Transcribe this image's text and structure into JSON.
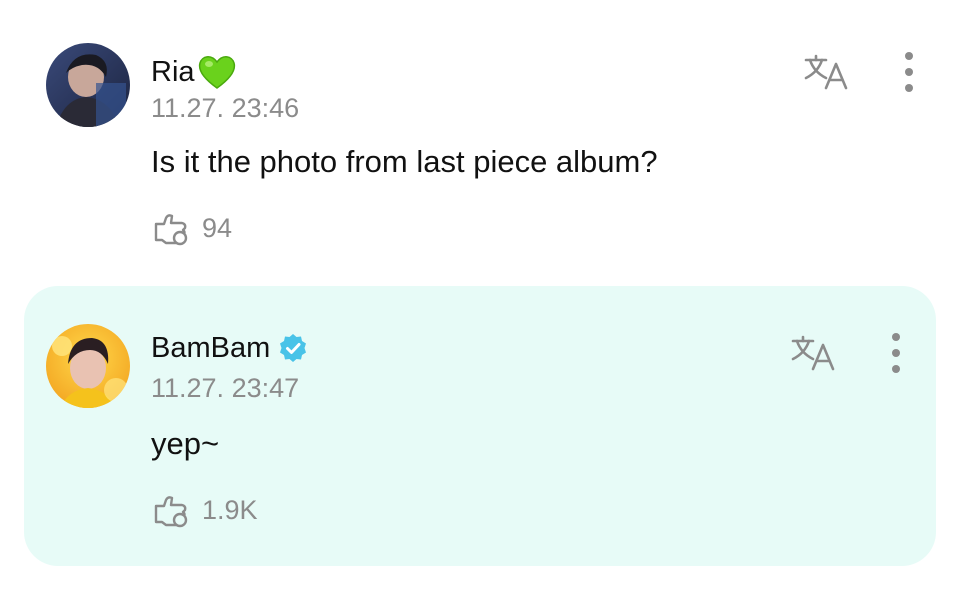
{
  "comments": [
    {
      "author": "Ria",
      "author_emoji": "green-heart-icon",
      "timestamp": "11.27. 23:46",
      "text": "Is it the photo from last piece album?",
      "likes": "94",
      "highlighted": false
    },
    {
      "author": "BamBam",
      "verified": true,
      "timestamp": "11.27. 23:47",
      "text": "yep~",
      "likes": "1.9K",
      "highlighted": true
    }
  ],
  "colors": {
    "highlight_background": "#e7fbf7",
    "verified_badge": "#49c3e8",
    "muted_text": "#8b8b8b",
    "heart": "#6ad21c"
  },
  "icons": {
    "translate": "translate-icon",
    "more": "more-vertical-icon",
    "like": "like-hand-icon"
  }
}
